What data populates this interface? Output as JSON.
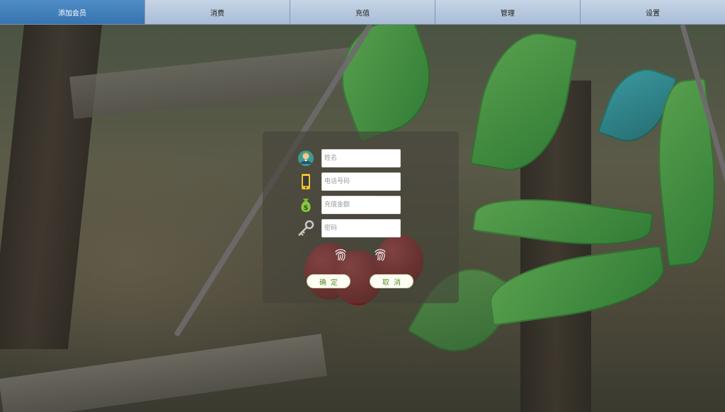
{
  "nav": {
    "items": [
      {
        "label": "添加会员",
        "active": true
      },
      {
        "label": "消费",
        "active": false
      },
      {
        "label": "充值",
        "active": false
      },
      {
        "label": "管理",
        "active": false
      },
      {
        "label": "设置",
        "active": false
      }
    ],
    "colors": {
      "active_bg": "#3674b0",
      "bg": "#a9bdd6"
    }
  },
  "form": {
    "name_placeholder": "姓名",
    "phone_placeholder": "电话号码",
    "amount_placeholder": "充值金额",
    "password_placeholder": "密码",
    "icons": [
      "user-avatar-icon",
      "mobile-phone-icon",
      "money-bag-icon",
      "key-icon",
      "fingerprint-icon"
    ],
    "confirm_label": "确定",
    "cancel_label": "取消"
  }
}
